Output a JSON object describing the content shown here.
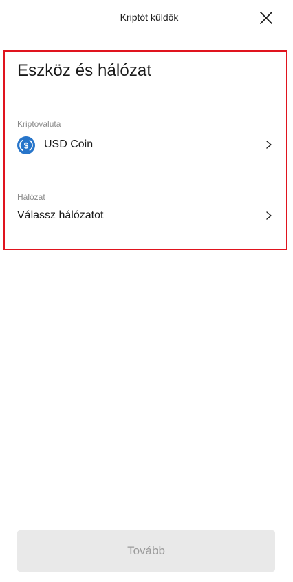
{
  "header": {
    "title": "Kriptót küldök",
    "close_icon": "close-icon"
  },
  "section": {
    "title": "Eszköz és hálózat"
  },
  "crypto": {
    "label": "Kriptovaluta",
    "value": "USD Coin",
    "icon": "usdc-coin-icon",
    "icon_color": "#2775CA"
  },
  "network": {
    "label": "Hálózat",
    "value": "Válassz hálózatot"
  },
  "footer": {
    "next_label": "Tovább"
  },
  "colors": {
    "highlight": "#e0141e",
    "disabled_button_bg": "#e9e9e9",
    "disabled_button_text": "#9a9a9a"
  }
}
